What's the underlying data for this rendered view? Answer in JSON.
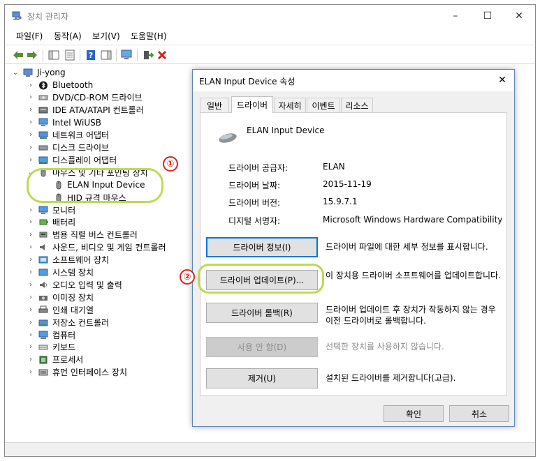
{
  "window": {
    "title": "장치 관리자",
    "controls": {
      "minimize": "–",
      "maximize": "☐",
      "close": "✕"
    }
  },
  "menu": [
    "파일(F)",
    "동작(A)",
    "보기(V)",
    "도움말(H)"
  ],
  "tree": {
    "root": "Ji-yong",
    "items": [
      {
        "label": "Bluetooth",
        "icon": "bluetooth-icon"
      },
      {
        "label": "DVD/CD-ROM 드라이브",
        "icon": "dvd-drive-icon"
      },
      {
        "label": "IDE ATA/ATAPI 컨트롤러",
        "icon": "ide-controller-icon"
      },
      {
        "label": "Intel WiUSB",
        "icon": "monitor-icon"
      },
      {
        "label": "네트워크 어댑터",
        "icon": "network-adapter-icon"
      },
      {
        "label": "디스크 드라이브",
        "icon": "disk-drive-icon"
      },
      {
        "label": "디스플레이 어댑터",
        "icon": "display-adapter-icon"
      },
      {
        "label": "마우스 및 기타 포인팅 장치",
        "icon": "mouse-icon",
        "expanded": true,
        "children": [
          "ELAN Input Device",
          "HID 규격 마우스"
        ]
      },
      {
        "label": "모니터",
        "icon": "monitor-icon"
      },
      {
        "label": "배터리",
        "icon": "battery-icon"
      },
      {
        "label": "범용 직렬 버스 컨트롤러",
        "icon": "usb-icon"
      },
      {
        "label": "사운드, 비디오 및 게임 컨트롤러",
        "icon": "speaker-icon"
      },
      {
        "label": "소프트웨어 장치",
        "icon": "software-device-icon"
      },
      {
        "label": "시스템 장치",
        "icon": "system-device-icon"
      },
      {
        "label": "오디오 입력 및 출력",
        "icon": "audio-icon"
      },
      {
        "label": "이미징 장치",
        "icon": "camera-icon"
      },
      {
        "label": "인쇄 대기열",
        "icon": "printer-icon"
      },
      {
        "label": "저장소 컨트롤러",
        "icon": "storage-controller-icon"
      },
      {
        "label": "컴퓨터",
        "icon": "computer-icon"
      },
      {
        "label": "키보드",
        "icon": "keyboard-icon"
      },
      {
        "label": "프로세서",
        "icon": "processor-icon"
      },
      {
        "label": "휴먼 인터페이스 장치",
        "icon": "hid-icon"
      }
    ]
  },
  "annotations": {
    "one": "①",
    "two": "②"
  },
  "dialog": {
    "title": "ELAN Input Device 속성",
    "close": "✕",
    "tabs": [
      "일반",
      "드라이버",
      "자세히",
      "이벤트",
      "리소스"
    ],
    "active_tab": "드라이버",
    "device_name": "ELAN Input Device",
    "properties": [
      {
        "label": "드라이버 공급자:",
        "value": "ELAN"
      },
      {
        "label": "드라이버 날짜:",
        "value": "2015-11-19"
      },
      {
        "label": "드라이버 버전:",
        "value": "15.9.7.1"
      },
      {
        "label": "디지털 서명자:",
        "value": "Microsoft Windows Hardware Compatibility"
      }
    ],
    "actions": [
      {
        "button": "드라이버 정보(I)",
        "desc": "드라이버 파일에 대한 세부 정보를 표시합니다."
      },
      {
        "button": "드라이버 업데이트(P)...",
        "desc": "이 장치용 드라이버 소프트웨어를 업데이트합니다."
      },
      {
        "button": "드라이버 롤백(R)",
        "desc": "드라이버 업데이트 후 장치가 작동하지 않는 경우 이전 드라이버로 롤백합니다."
      },
      {
        "button": "사용 안 함(D)",
        "desc": "선택한 장치를 사용하지 않습니다.",
        "disabled": true
      },
      {
        "button": "제거(U)",
        "desc": "설치된 드라이버를 제거합니다(고급)."
      }
    ],
    "ok": "확인",
    "cancel": "취소"
  },
  "colors": {
    "annotation_green": "#b9dc52",
    "annotation_red": "#d9241c",
    "focus_blue": "#0078d7"
  }
}
